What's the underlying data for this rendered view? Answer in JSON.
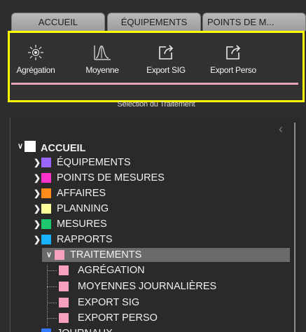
{
  "tabs": [
    {
      "label": "ACCUEIL"
    },
    {
      "label": "ÉQUIPEMENTS"
    },
    {
      "label": "POINTS DE M..."
    }
  ],
  "ribbon": {
    "tools": [
      {
        "label": "Agrégation",
        "icon": "sun-icon"
      },
      {
        "label": "Moyenne",
        "icon": "peak-chart-icon"
      },
      {
        "label": "Export SIG",
        "icon": "export-icon"
      },
      {
        "label": "Export Perso",
        "icon": "export-icon"
      }
    ],
    "caption": "Sélection du Traitement",
    "accent_color": "#e8a0bf",
    "highlight_color": "#ffff00"
  },
  "tree": {
    "root": {
      "label": "ACCUEIL",
      "color": "#ffffff",
      "expanded": true
    },
    "items": [
      {
        "label": "ÉQUIPEMENTS",
        "color": "#9966ff"
      },
      {
        "label": "POINTS DE MESURES",
        "color": "#ff33cc"
      },
      {
        "label": "AFFAIRES",
        "color": "#ff8c1a"
      },
      {
        "label": "PLANNING",
        "color": "#ffff99"
      },
      {
        "label": "MESURES",
        "color": "#1ec86e"
      },
      {
        "label": "RAPPORTS",
        "color": "#1ab2ff"
      },
      {
        "label": "TRAITEMENTS",
        "color": "#f7a1bd",
        "expanded": true,
        "selected": true
      }
    ],
    "children": [
      {
        "label": "AGRÉGATION",
        "color": "#f7a1bd"
      },
      {
        "label": "MOYENNES JOURNALIÈRES",
        "color": "#f7a1bd"
      },
      {
        "label": "EXPORT SIG",
        "color": "#f7a1bd"
      },
      {
        "label": "EXPORT PERSO",
        "color": "#f7a1bd"
      }
    ],
    "trailing": {
      "label": "JOURNAUX",
      "color": "#3377ff"
    }
  }
}
